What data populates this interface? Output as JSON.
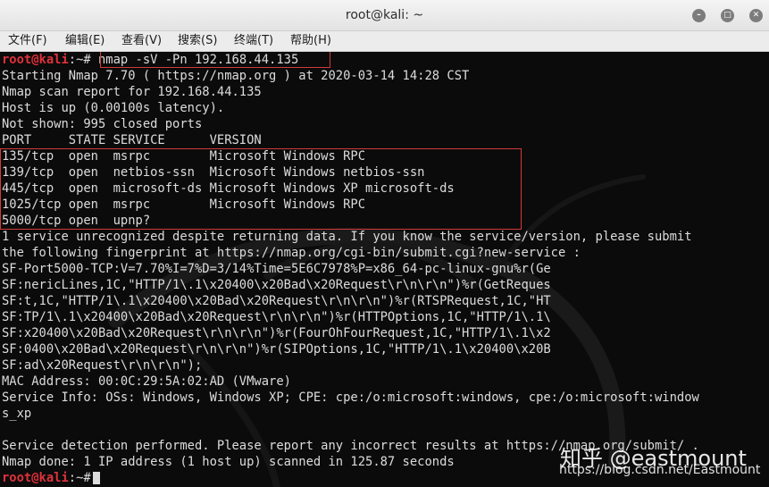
{
  "window": {
    "title": "root@kali: ~",
    "minimize_glyph": "–",
    "maximize_glyph": "□",
    "close_glyph": "✕"
  },
  "menu": [
    {
      "label": "文件(F)"
    },
    {
      "label": "编辑(E)"
    },
    {
      "label": "查看(V)"
    },
    {
      "label": "搜索(S)"
    },
    {
      "label": "终端(T)"
    },
    {
      "label": "帮助(H)"
    }
  ],
  "terminal": {
    "prompt_user": "root@kali",
    "prompt_path": ":~#",
    "command": " nmap -sV -Pn 192.168.44.135",
    "lines": [
      "Starting Nmap 7.70 ( https://nmap.org ) at 2020-03-14 14:28 CST",
      "Nmap scan report for 192.168.44.135",
      "Host is up (0.00100s latency).",
      "Not shown: 995 closed ports",
      "PORT     STATE SERVICE      VERSION",
      "135/tcp  open  msrpc        Microsoft Windows RPC",
      "139/tcp  open  netbios-ssn  Microsoft Windows netbios-ssn",
      "445/tcp  open  microsoft-ds Microsoft Windows XP microsoft-ds",
      "1025/tcp open  msrpc        Microsoft Windows RPC",
      "5000/tcp open  upnp?",
      "1 service unrecognized despite returning data. If you know the service/version, please submit",
      "the following fingerprint at https://nmap.org/cgi-bin/submit.cgi?new-service :",
      "SF-Port5000-TCP:V=7.70%I=7%D=3/14%Time=5E6C7978%P=x86_64-pc-linux-gnu%r(Ge",
      "SF:nericLines,1C,\"HTTP/1\\.1\\x20400\\x20Bad\\x20Request\\r\\n\\r\\n\")%r(GetReques",
      "SF:t,1C,\"HTTP/1\\.1\\x20400\\x20Bad\\x20Request\\r\\n\\r\\n\")%r(RTSPRequest,1C,\"HT",
      "SF:TP/1\\.1\\x20400\\x20Bad\\x20Request\\r\\n\\r\\n\")%r(HTTPOptions,1C,\"HTTP/1\\.1\\",
      "SF:x20400\\x20Bad\\x20Request\\r\\n\\r\\n\")%r(FourOhFourRequest,1C,\"HTTP/1\\.1\\x2",
      "SF:0400\\x20Bad\\x20Request\\r\\n\\r\\n\")%r(SIPOptions,1C,\"HTTP/1\\.1\\x20400\\x20B",
      "SF:ad\\x20Request\\r\\n\\r\\n\");",
      "MAC Address: 00:0C:29:5A:02:AD (VMware)",
      "Service Info: OSs: Windows, Windows XP; CPE: cpe:/o:microsoft:windows, cpe:/o:microsoft:window",
      "s_xp",
      "",
      "Service detection performed. Please report any incorrect results at https://nmap.org/submit/ .",
      "Nmap done: 1 IP address (1 host up) scanned in 125.87 seconds"
    ],
    "final_prompt_path": ":~#"
  },
  "watermark": {
    "zhihu": "知乎 @eastmount",
    "csdn": "https://blog.csdn.net/Eastmount"
  },
  "colors": {
    "terminal_bg": "#0b0b0b",
    "terminal_fg": "#dcdcdc",
    "prompt_red": "#e0313b",
    "highlight_box": "#d23a3a"
  }
}
